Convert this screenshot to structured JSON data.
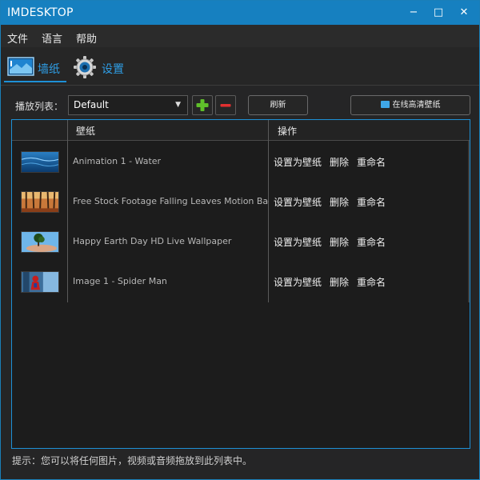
{
  "window": {
    "title": "IMDESKTOP",
    "min": "−",
    "max": "□",
    "close": "✕"
  },
  "menu": {
    "file": "文件",
    "language": "语言",
    "help": "帮助"
  },
  "tabs": {
    "wallpaper": "墙纸",
    "settings": "设置"
  },
  "toolbar": {
    "playlist_label": "播放列表：",
    "playlist_value": "Default",
    "caret": "▼",
    "add": "+",
    "remove": "−",
    "refresh": "刷新",
    "online": "在线高清壁纸"
  },
  "table": {
    "headers": {
      "wallpaper": "壁纸",
      "actions": "操作"
    },
    "rows": [
      {
        "title": "Animation 1 - Water",
        "set": "设置为壁纸",
        "delete": "删除",
        "rename": "重命名"
      },
      {
        "title": "Free Stock Footage Falling Leaves Motion Background",
        "set": "设置为壁纸",
        "delete": "删除",
        "rename": "重命名"
      },
      {
        "title": "Happy Earth Day HD Live Wallpaper",
        "set": "设置为壁纸",
        "delete": "删除",
        "rename": "重命名"
      },
      {
        "title": "Image 1 - Spider Man",
        "set": "设置为壁纸",
        "delete": "删除",
        "rename": "重命名"
      }
    ]
  },
  "hint": "提示：您可以将任何图片，视频或音频拖放到此列表中。",
  "colors": {
    "accent": "#1e90d6",
    "titlebar": "#1680c0",
    "add_green": "#5fbf2a",
    "remove_red": "#e23030"
  }
}
